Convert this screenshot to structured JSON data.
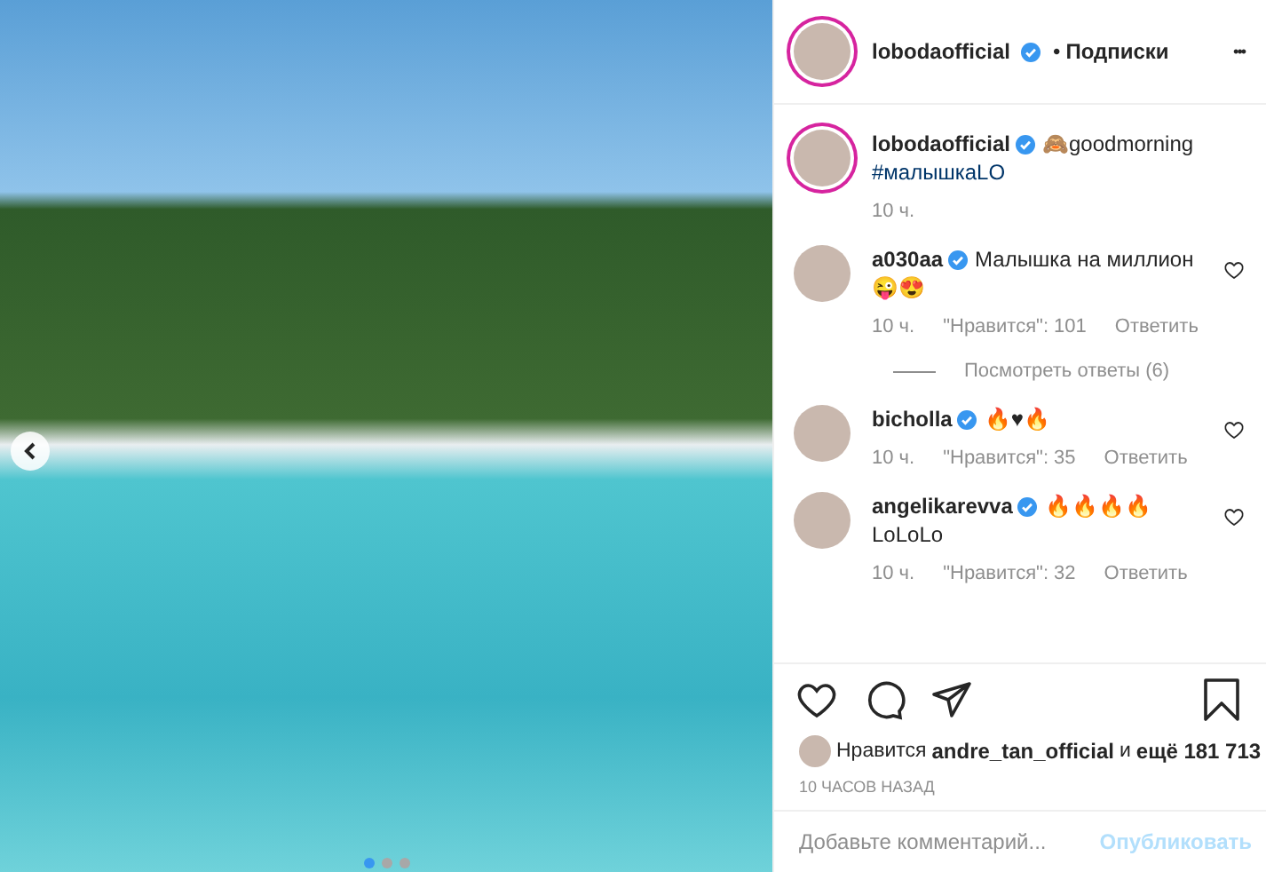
{
  "photo": {
    "carousel_prev": true,
    "dots": [
      {
        "selected": true
      },
      {
        "selected": false
      },
      {
        "selected": false
      }
    ]
  },
  "header": {
    "username": "lobodaofficial",
    "verified": true,
    "separator": "•",
    "follow": "Подписки",
    "more": "•••"
  },
  "caption": {
    "username": "lobodaofficial",
    "verified": true,
    "text": "🙈goodmorning",
    "hashtag": "#малышкаLO",
    "time": "10 ч."
  },
  "comments": [
    {
      "username": "a030aa",
      "verified": true,
      "lines": [
        "Малышка на миллион",
        "😜😍"
      ],
      "time": "10 ч.",
      "likes": "\"Нравится\": 101",
      "reply": "Ответить",
      "liked": false,
      "view_replies": "Посмотреть ответы (6)"
    },
    {
      "username": "bicholla",
      "verified": true,
      "lines": [
        "🔥♥🔥"
      ],
      "time": "10 ч.",
      "likes": "\"Нравится\": 35",
      "reply": "Ответить",
      "liked": false
    },
    {
      "username": "angelikarevva",
      "verified": true,
      "lines": [
        "🔥🔥🔥🔥",
        "LoLoLo"
      ],
      "time": "10 ч.",
      "likes": "\"Нравится\": 32",
      "reply": "Ответить",
      "liked": false
    }
  ],
  "actions": {
    "liked": false,
    "saved": false
  },
  "likes": {
    "prefix": "Нравится",
    "user": "andre_tan_official",
    "middle": "и",
    "count": "ещё 181 713"
  },
  "posted": "10 ЧАСОВ НАЗАД",
  "comment_box": {
    "placeholder": "Добавьте комментарий...",
    "publish": "Опубликовать",
    "disabled": true
  }
}
